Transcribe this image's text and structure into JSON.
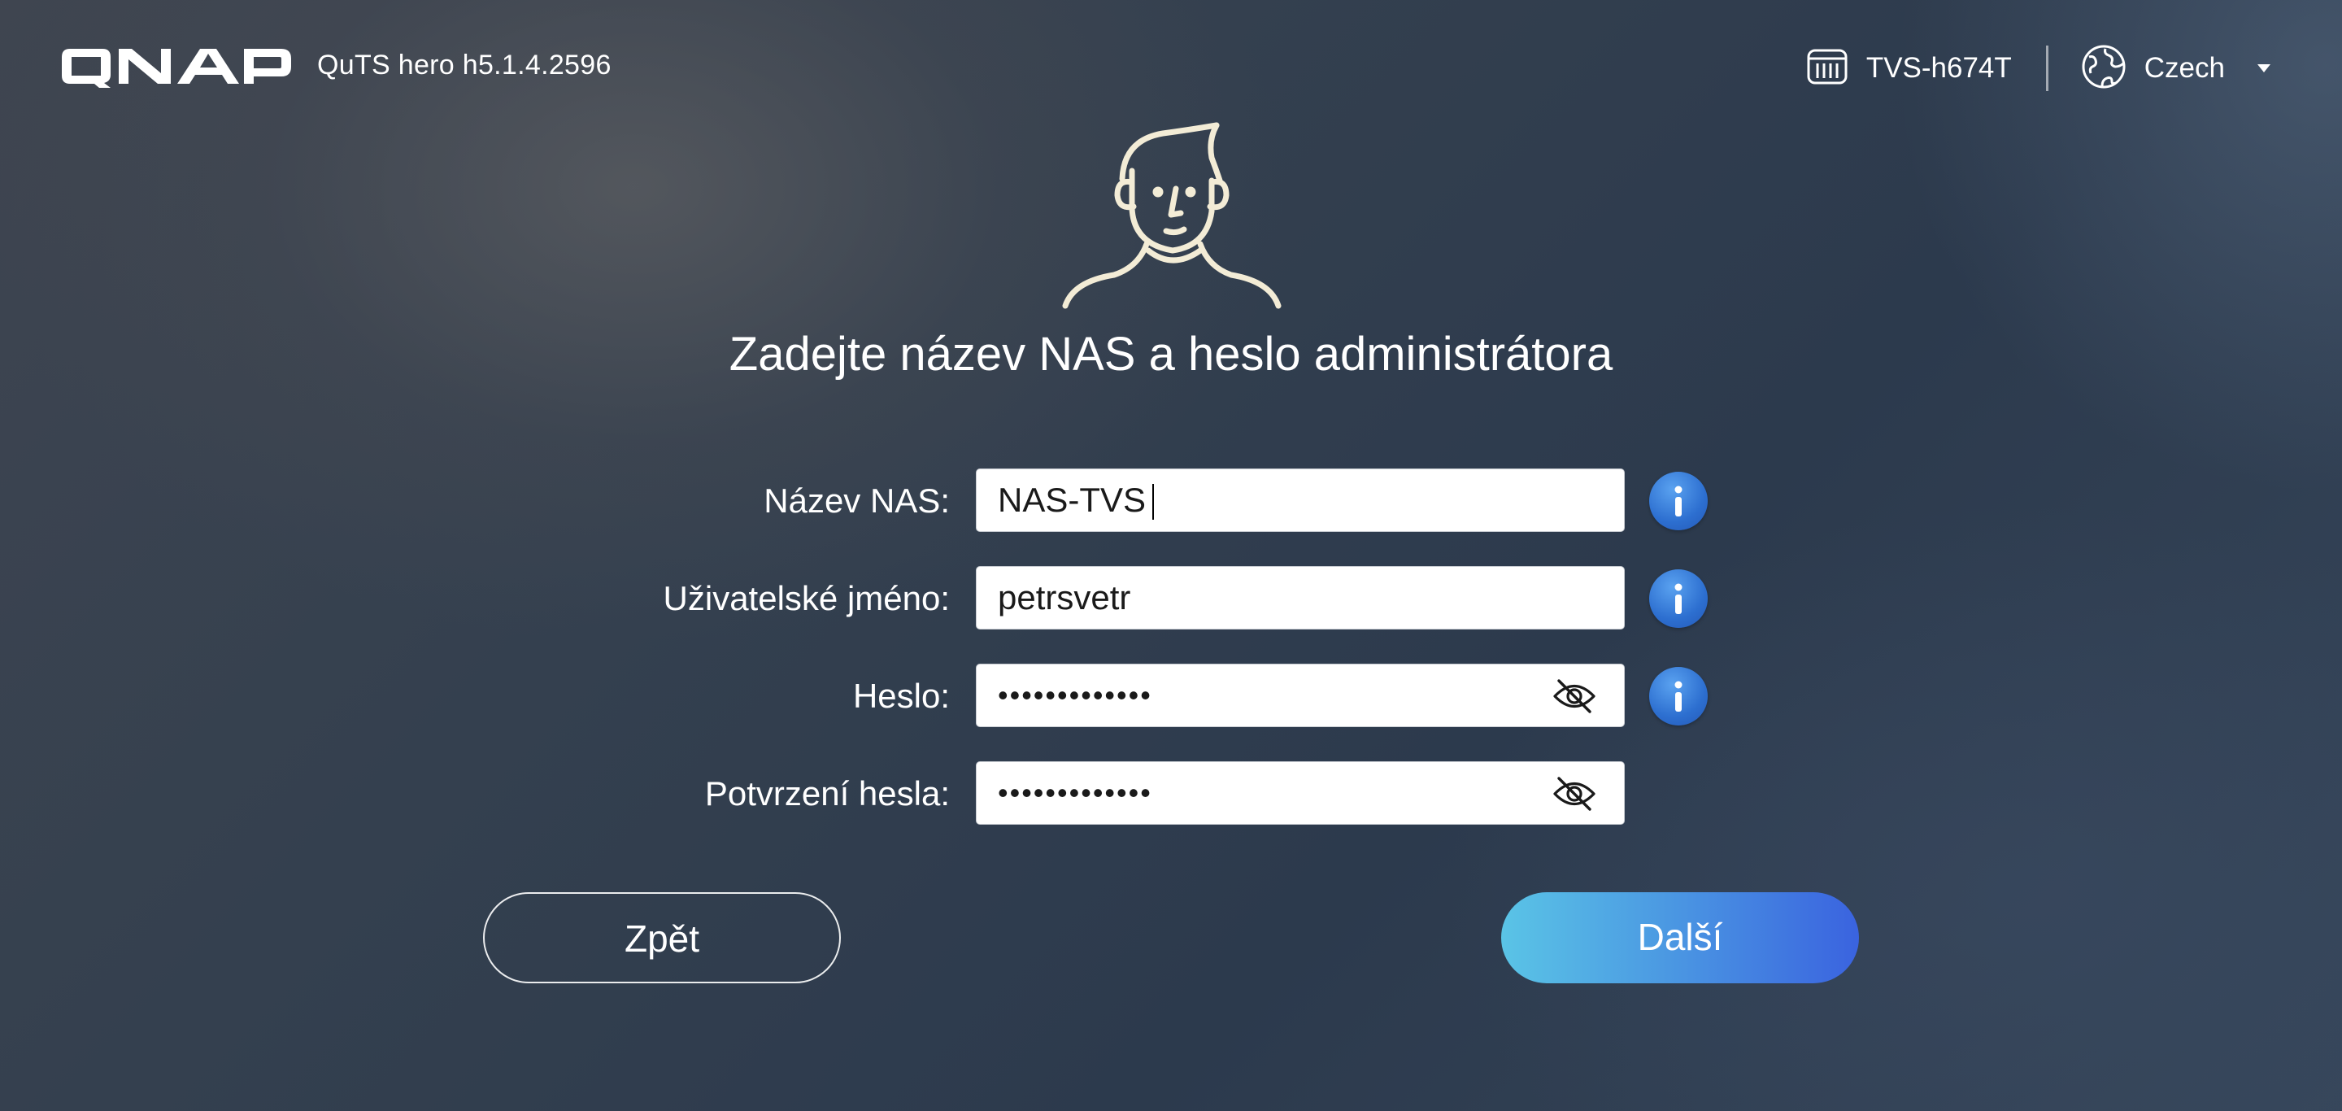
{
  "header": {
    "logo_text": "QNAP",
    "version": "QuTS hero h5.1.4.2596",
    "model": "TVS-h674T",
    "model_icon": "nas-device-icon",
    "language": "Czech",
    "language_icon": "globe-icon"
  },
  "page": {
    "title": "Zadejte název NAS a heslo administrátora",
    "avatar_icon": "user-avatar-icon"
  },
  "form": {
    "nas_name": {
      "label": "Název NAS:",
      "value": "NAS-TVS"
    },
    "username": {
      "label": "Uživatelské jméno:",
      "value": "petrsvetr"
    },
    "password": {
      "label": "Heslo:",
      "value": "•••••••••••••",
      "icon": "eye-off-icon"
    },
    "confirm_password": {
      "label": "Potvrzení hesla:",
      "value": "•••••••••••••",
      "icon": "eye-off-icon"
    }
  },
  "buttons": {
    "back": "Zpět",
    "next": "Další"
  },
  "colors": {
    "accent_start": "#5ac4e6",
    "accent_end": "#3a63df",
    "info_blue": "#2d6fd0",
    "avatar_stroke": "#f3ecd6"
  }
}
